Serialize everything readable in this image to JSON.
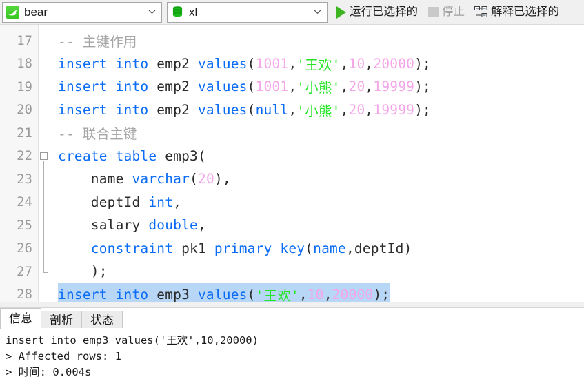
{
  "toolbar": {
    "connection": {
      "value": "bear",
      "icon": "mysql-connection-icon"
    },
    "database": {
      "value": "xl",
      "icon": "database-icon"
    },
    "run_selected_label": "运行已选择的",
    "stop_label": "停止",
    "explain_selected_label": "解释已选择的"
  },
  "editor": {
    "first_line_number": 17,
    "lines": [
      {
        "n": 17,
        "tokens": [
          {
            "t": "-- 主键作用",
            "c": "cmt"
          }
        ]
      },
      {
        "n": 18,
        "tokens": [
          {
            "t": "insert into",
            "c": "kw"
          },
          {
            "t": " emp2 ",
            "c": "id"
          },
          {
            "t": "values",
            "c": "kw"
          },
          {
            "t": "(",
            "c": "punc"
          },
          {
            "t": "1001",
            "c": "num"
          },
          {
            "t": ",",
            "c": "punc"
          },
          {
            "t": "'王欢'",
            "c": "str"
          },
          {
            "t": ",",
            "c": "punc"
          },
          {
            "t": "10",
            "c": "num"
          },
          {
            "t": ",",
            "c": "punc"
          },
          {
            "t": "20000",
            "c": "num"
          },
          {
            "t": ");",
            "c": "punc"
          }
        ]
      },
      {
        "n": 19,
        "tokens": [
          {
            "t": "insert into",
            "c": "kw"
          },
          {
            "t": " emp2 ",
            "c": "id"
          },
          {
            "t": "values",
            "c": "kw"
          },
          {
            "t": "(",
            "c": "punc"
          },
          {
            "t": "1001",
            "c": "num"
          },
          {
            "t": ",",
            "c": "punc"
          },
          {
            "t": "'小熊'",
            "c": "str"
          },
          {
            "t": ",",
            "c": "punc"
          },
          {
            "t": "20",
            "c": "num"
          },
          {
            "t": ",",
            "c": "punc"
          },
          {
            "t": "19999",
            "c": "num"
          },
          {
            "t": ");",
            "c": "punc"
          }
        ]
      },
      {
        "n": 20,
        "tokens": [
          {
            "t": "insert into",
            "c": "kw"
          },
          {
            "t": " emp2 ",
            "c": "id"
          },
          {
            "t": "values",
            "c": "kw"
          },
          {
            "t": "(",
            "c": "punc"
          },
          {
            "t": "null",
            "c": "kw"
          },
          {
            "t": ",",
            "c": "punc"
          },
          {
            "t": "'小熊'",
            "c": "str"
          },
          {
            "t": ",",
            "c": "punc"
          },
          {
            "t": "20",
            "c": "num"
          },
          {
            "t": ",",
            "c": "punc"
          },
          {
            "t": "19999",
            "c": "num"
          },
          {
            "t": ");",
            "c": "punc"
          }
        ]
      },
      {
        "n": 21,
        "tokens": [
          {
            "t": "-- 联合主键",
            "c": "cmt"
          }
        ]
      },
      {
        "n": 22,
        "fold": "start",
        "tokens": [
          {
            "t": "create table",
            "c": "kw"
          },
          {
            "t": " emp3",
            "c": "id"
          },
          {
            "t": "(",
            "c": "punc"
          }
        ]
      },
      {
        "n": 23,
        "tokens": [
          {
            "t": "    name ",
            "c": "id"
          },
          {
            "t": "varchar",
            "c": "kw"
          },
          {
            "t": "(",
            "c": "punc"
          },
          {
            "t": "20",
            "c": "num"
          },
          {
            "t": "),",
            "c": "punc"
          }
        ]
      },
      {
        "n": 24,
        "tokens": [
          {
            "t": "    deptId ",
            "c": "id"
          },
          {
            "t": "int",
            "c": "kw"
          },
          {
            "t": ",",
            "c": "punc"
          }
        ]
      },
      {
        "n": 25,
        "tokens": [
          {
            "t": "    salary ",
            "c": "id"
          },
          {
            "t": "double",
            "c": "kw"
          },
          {
            "t": ",",
            "c": "punc"
          }
        ]
      },
      {
        "n": 26,
        "tokens": [
          {
            "t": "    ",
            "c": "id"
          },
          {
            "t": "constraint",
            "c": "kw"
          },
          {
            "t": " pk1 ",
            "c": "id"
          },
          {
            "t": "primary key",
            "c": "kw"
          },
          {
            "t": "(",
            "c": "punc"
          },
          {
            "t": "name",
            "c": "kw"
          },
          {
            "t": ",",
            "c": "punc"
          },
          {
            "t": "deptId",
            "c": "id"
          },
          {
            "t": ")",
            "c": "punc"
          }
        ]
      },
      {
        "n": 27,
        "fold": "end",
        "tokens": [
          {
            "t": "    );",
            "c": "punc"
          }
        ]
      },
      {
        "n": 28,
        "selected": true,
        "tokens": [
          {
            "t": "insert into",
            "c": "kw"
          },
          {
            "t": " emp3 ",
            "c": "id"
          },
          {
            "t": "values",
            "c": "kw"
          },
          {
            "t": "(",
            "c": "punc"
          },
          {
            "t": "'王欢'",
            "c": "str"
          },
          {
            "t": ",",
            "c": "punc"
          },
          {
            "t": "10",
            "c": "num"
          },
          {
            "t": ",",
            "c": "punc"
          },
          {
            "t": "20000",
            "c": "num"
          },
          {
            "t": ");",
            "c": "punc"
          }
        ]
      }
    ]
  },
  "bottom": {
    "tabs": [
      {
        "label": "信息",
        "active": true
      },
      {
        "label": "剖析",
        "active": false
      },
      {
        "label": "状态",
        "active": false
      }
    ],
    "output_lines": [
      "insert into emp3 values('王欢',10,20000)",
      "> Affected rows: 1",
      "> 时间: 0.004s"
    ]
  },
  "colors": {
    "keyword": "#0a6cf5",
    "number": "#f3a6e8",
    "string": "#25e425",
    "comment": "#a6a6a6",
    "selection": "#b8d6f5",
    "run_green": "#3cb521",
    "db_green": "#14a014"
  }
}
